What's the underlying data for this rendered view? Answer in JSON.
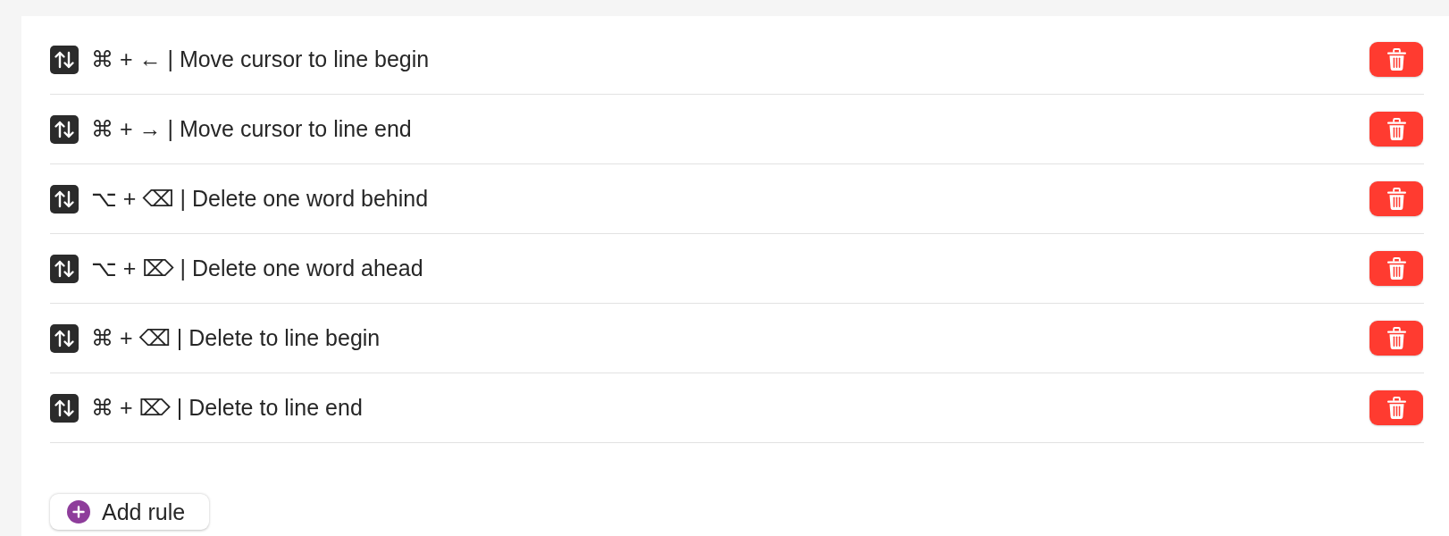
{
  "rules": [
    {
      "label": "⌘ + ← | Move cursor to line begin"
    },
    {
      "label": "⌘ + → | Move cursor to line end"
    },
    {
      "label": "⌥ + ⌫ | Delete one word behind"
    },
    {
      "label": "⌥ + ⌦ | Delete one word ahead"
    },
    {
      "label": "⌘ + ⌫ | Delete to line begin"
    },
    {
      "label": "⌘ + ⌦ | Delete to line end"
    }
  ],
  "add_button": {
    "label": "Add rule"
  }
}
